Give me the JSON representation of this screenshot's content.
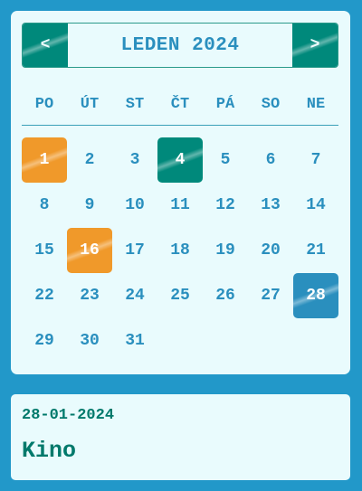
{
  "calendar": {
    "month_title": "LEDEN 2024",
    "prev_label": "<",
    "next_label": ">",
    "weekdays": [
      "PO",
      "ÚT",
      "ST",
      "ČT",
      "PÁ",
      "SO",
      "NE"
    ],
    "days": [
      {
        "day": "1",
        "style": "orange"
      },
      {
        "day": "2"
      },
      {
        "day": "3"
      },
      {
        "day": "4",
        "style": "teal"
      },
      {
        "day": "5"
      },
      {
        "day": "6"
      },
      {
        "day": "7"
      },
      {
        "day": "8"
      },
      {
        "day": "9"
      },
      {
        "day": "10"
      },
      {
        "day": "11"
      },
      {
        "day": "12"
      },
      {
        "day": "13"
      },
      {
        "day": "14"
      },
      {
        "day": "15"
      },
      {
        "day": "16",
        "style": "orange"
      },
      {
        "day": "17"
      },
      {
        "day": "18"
      },
      {
        "day": "19"
      },
      {
        "day": "20"
      },
      {
        "day": "21"
      },
      {
        "day": "22"
      },
      {
        "day": "23"
      },
      {
        "day": "24"
      },
      {
        "day": "25"
      },
      {
        "day": "26"
      },
      {
        "day": "27"
      },
      {
        "day": "28",
        "style": "blue"
      },
      {
        "day": "29"
      },
      {
        "day": "30"
      },
      {
        "day": "31"
      }
    ]
  },
  "event": {
    "date": "28-01-2024",
    "title": "Kino"
  },
  "colors": {
    "background": "#2298c9",
    "card": "#e9fbfd",
    "primary_text": "#2a8fbe",
    "teal": "#00897b",
    "orange": "#f0992a",
    "selected_blue": "#2a8fbe"
  }
}
